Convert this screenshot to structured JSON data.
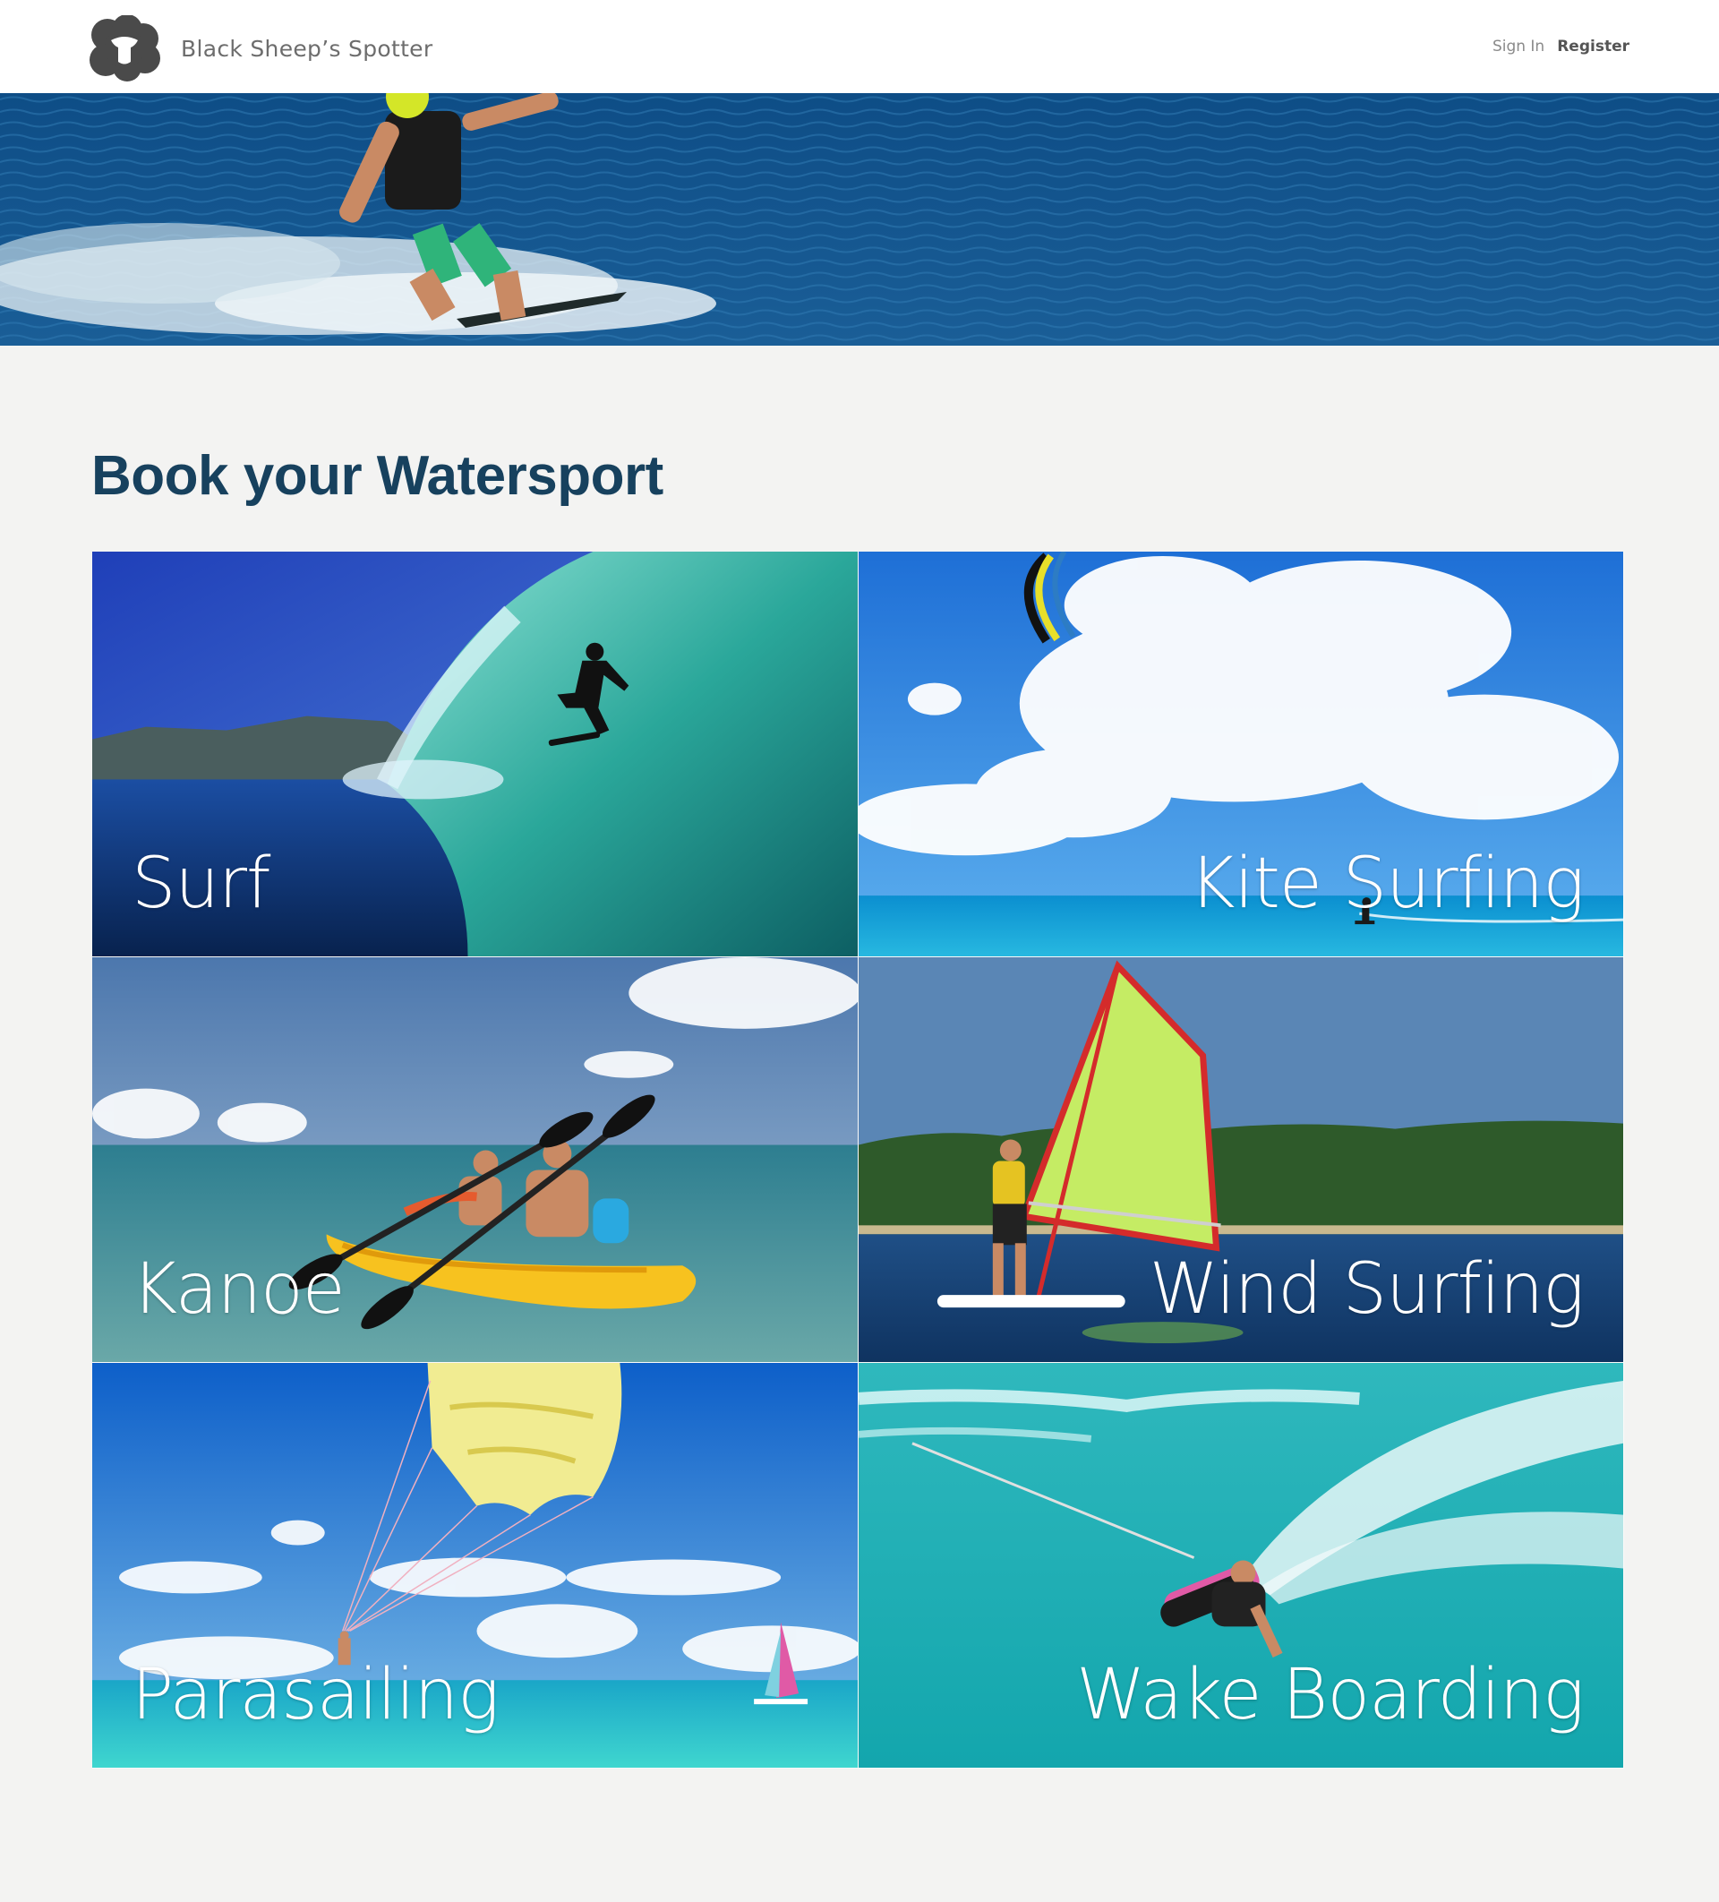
{
  "header": {
    "brand_name": "Black Sheep’s Spotter",
    "logo_icon": "sheep-logo-icon",
    "sign_in_label": "Sign In",
    "register_label": "Register"
  },
  "main": {
    "title": "Book your Watersport",
    "sports": [
      {
        "label": "Surf",
        "image": "surfer-in-wave-tube"
      },
      {
        "label": "Kite Surfing",
        "image": "kite-surfer-under-clouds"
      },
      {
        "label": "Kanoe",
        "image": "couple-in-yellow-kayak"
      },
      {
        "label": "Wind Surfing",
        "image": "windsurfer-green-sail"
      },
      {
        "label": "Parasailing",
        "image": "parasailer-yellow-parachute"
      },
      {
        "label": "Wake Boarding",
        "image": "wakeboarder-spraying-water"
      }
    ]
  },
  "colors": {
    "title": "#17415e",
    "page_background": "#f3f3f2",
    "header_background": "#ffffff"
  }
}
